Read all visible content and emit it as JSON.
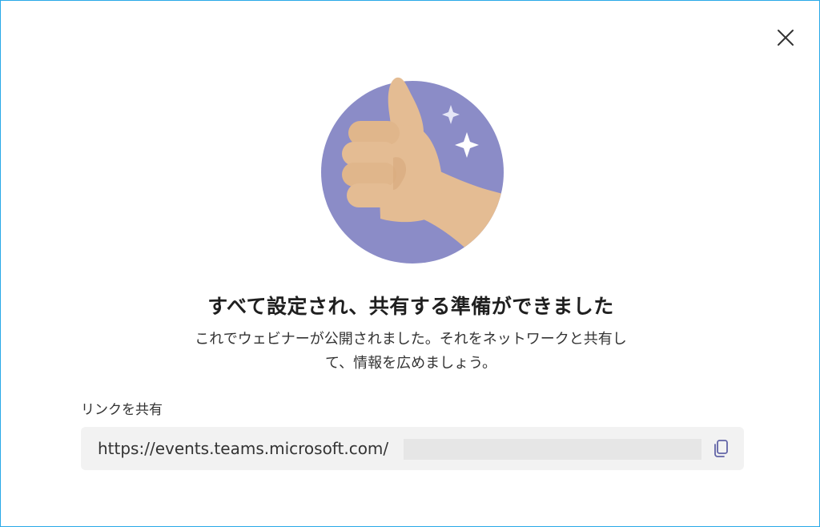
{
  "dialog": {
    "title": "すべて設定され、共有する準備ができました",
    "description_line1": "これでウェビナーが公開されました。それをネットワークと共有し",
    "description_line2": "て、情報を広めましょう。",
    "share_label": "リンクを共有",
    "link_url": "https://events.teams.microsoft.com/"
  },
  "icons": {
    "close": "close-icon",
    "copy": "copy-icon",
    "illustration": "thumbs-up-illustration"
  },
  "colors": {
    "border": "#29a9e8",
    "circle": "#8b8cc7",
    "skin": "#e4bc93",
    "copy_icon": "#6264a7"
  }
}
